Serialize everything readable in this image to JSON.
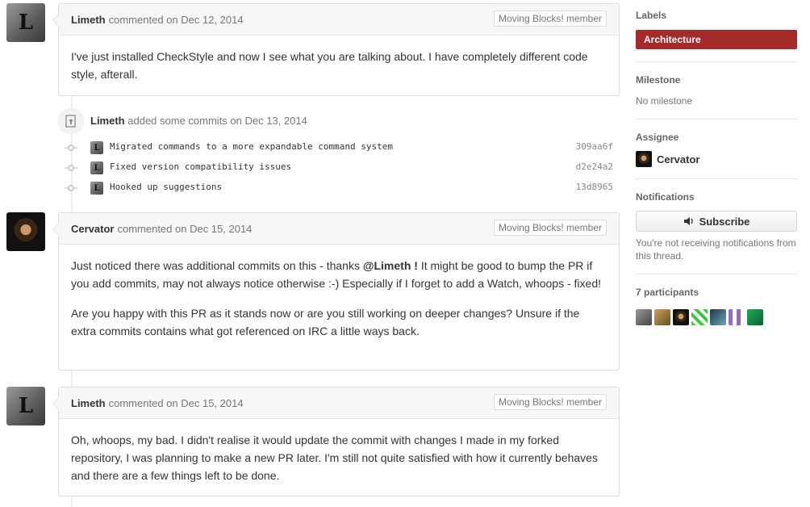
{
  "comments": [
    {
      "author": "Limeth",
      "meta": "commented on Dec 12, 2014",
      "badge": "Moving Blocks! member",
      "paragraphs": [
        "I've just installed CheckStyle and now I see what you are talking about. I have completely different code style, afterall."
      ]
    },
    {
      "author": "Cervator",
      "meta": "commented on Dec 15, 2014",
      "badge": "Moving Blocks! member",
      "p1_before": "Just noticed there was additional commits on this - thanks",
      "p1_mention": "@Limeth !",
      "p1_after": "It might be good to bump the PR if you add commits, may not always notice otherwise :-) Especially if I forget to add a Watch, whoops - fixed!",
      "p2": "Are you happy with this PR as it stands now or are you still working on deeper changes? Unsure if the extra commits contains what got referenced on IRC a little ways back."
    },
    {
      "author": "Limeth",
      "meta": "commented on Dec 15, 2014",
      "badge": "Moving Blocks! member",
      "paragraphs": [
        "Oh, whoops, my bad. I didn't realise it would update the commit with changes I made in my forked repository, I was planning to make a new PR later. I'm still not quite satisfied with how it currently behaves and there are a few things left to be done."
      ]
    }
  ],
  "event": {
    "author": "Limeth",
    "text": "added some commits on Dec 13, 2014"
  },
  "commits": [
    {
      "message": "Migrated commands to a more expandable command system",
      "sha": "309aa6f"
    },
    {
      "message": "Fixed version compatibility issues",
      "sha": "d2e24a2"
    },
    {
      "message": "Hooked up suggestions",
      "sha": "13d8965"
    }
  ],
  "avatar_letter": "L",
  "sidebar": {
    "labels_title": "Labels",
    "label": "Architecture",
    "label_color": "#a52a2a",
    "milestone_title": "Milestone",
    "milestone_value": "No milestone",
    "assignee_title": "Assignee",
    "assignee": "Cervator",
    "notifications_title": "Notifications",
    "subscribe_label": "Subscribe",
    "notifications_note": "You're not receiving notifications from this thread.",
    "participants_title": "7 participants"
  }
}
